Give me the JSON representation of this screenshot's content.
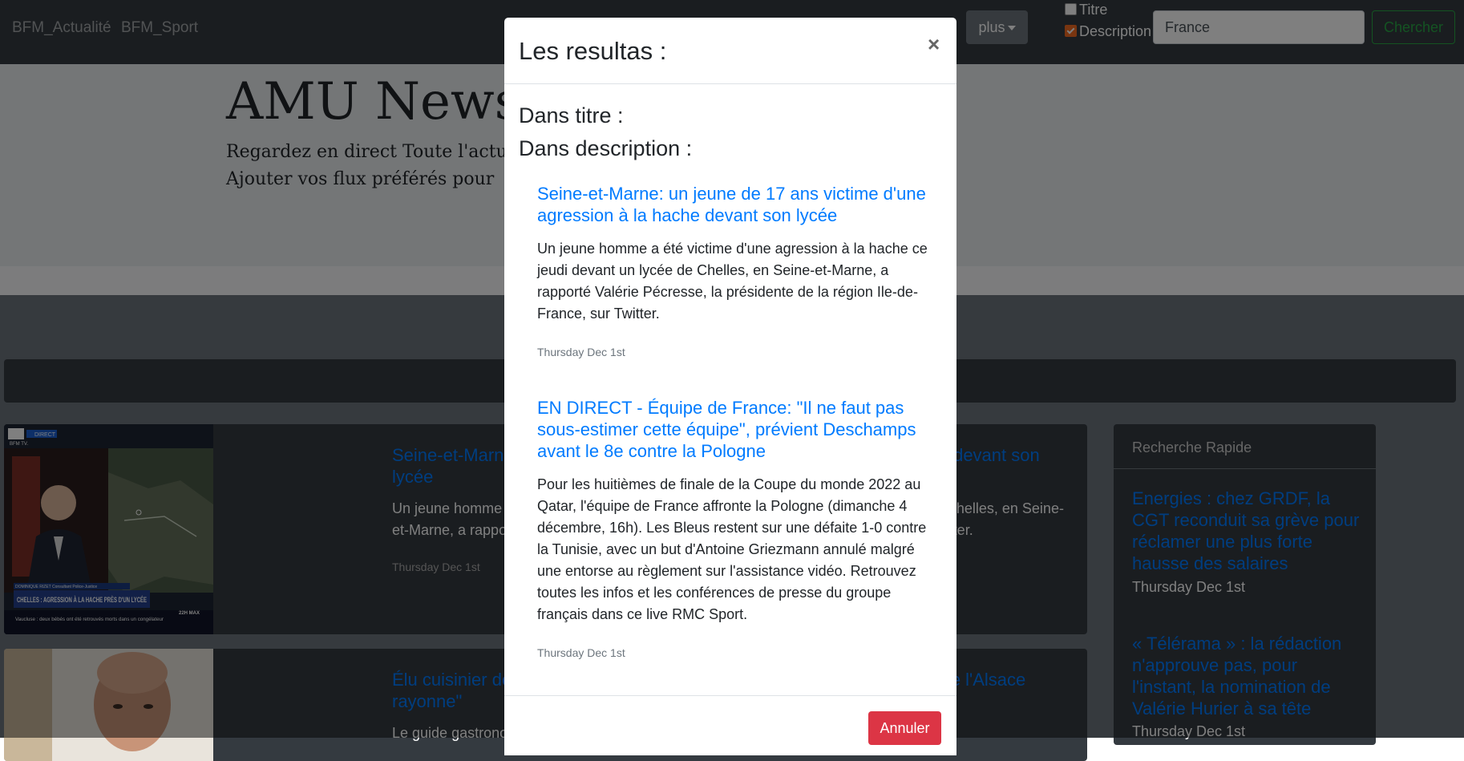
{
  "navbar": {
    "links": [
      "BFM_Actualité",
      "BFM_Sport"
    ],
    "more_label": "plus",
    "filters": [
      {
        "label": "Titre",
        "checked": false
      },
      {
        "label": "Description",
        "checked": true
      }
    ],
    "search_value": "France",
    "search_button": "Chercher"
  },
  "hero": {
    "title": "AMU News",
    "line1": "Regardez en direct Toute l'actualité",
    "line2": "Ajouter vos flux préférés pour"
  },
  "articles": [
    {
      "title": "Seine-et-Marne: un jeune de 17 ans victime d'une agression à la hache devant son lycée",
      "description": "Un jeune homme a été victime d'une agression à la hache ce jeudi devant un lycée de Chelles, en Seine-et-Marne, a rapporté Valérie Pécresse, la présidente de la région Ile-de-France, sur Twitter.",
      "date": "Thursday Dec 1st",
      "thumb_banner": "CHELLES : AGRESSION À LA HACHE PRÈS D'UN LYCÉE",
      "thumb_logo": "BFM TV.",
      "thumb_live": "DIRECT",
      "thumb_ticker": "Vaucluse : deux bébés ont été retrouvés morts dans un congélateur",
      "thumb_corner": "22H MAX",
      "thumb_name": "DOMINIQUE RIZET Consultant Police-Justice"
    },
    {
      "title": "Élu cuisinier de l'année, Michel Husser veut mettre son oeuvre \"pour que l'Alsace rayonne\"",
      "description": "Le guide gastronomique Gault et Millau a désigné le chef alsacien a",
      "date": ""
    }
  ],
  "sidebar": {
    "heading": "Recherche Rapide",
    "items": [
      {
        "title": "Energies : chez GRDF, la CGT reconduit sa grève pour réclamer une plus forte hausse des salaires",
        "date": "Thursday Dec 1st"
      },
      {
        "title": "« Télérama » : la rédaction n'approuve pas, pour l'instant, la nomination de Valérie Hurier à sa tête",
        "date": "Thursday Dec 1st"
      }
    ]
  },
  "modal": {
    "title": "Les resultas :",
    "close": "×",
    "in_title_label": "Dans titre :",
    "in_description_label": "Dans description :",
    "results": [
      {
        "title": "Seine-et-Marne: un jeune de 17 ans victime d'une agression à la hache devant son lycée",
        "description": "Un jeune homme a été victime d'une agression à la hache ce jeudi devant un lycée de Chelles, en Seine-et-Marne, a rapporté Valérie Pécresse, la présidente de la région Ile-de-France, sur Twitter.",
        "date": "Thursday Dec 1st"
      },
      {
        "title": "EN DIRECT - Équipe de France: \"Il ne faut pas sous-estimer cette équipe\", prévient Deschamps avant le 8e contre la Pologne",
        "description": "Pour les huitièmes de finale de la Coupe du monde 2022 au Qatar, l'équipe de France affronte la Pologne (dimanche 4 décembre, 16h). Les Bleus restent sur une défaite 1-0 contre la Tunisie, avec un but d'Antoine Griezmann annulé malgré une entorse au règlement sur l'assistance vidéo. Retrouvez toutes les infos et les conférences de presse du groupe français dans ce live RMC Sport.",
        "date": "Thursday Dec 1st"
      }
    ],
    "cancel_label": "Annuler"
  },
  "colors": {
    "navbar": "#343a40",
    "link": "#007bff",
    "success": "#28a745",
    "danger": "#dc3545",
    "checkbox_accent": "#f36a21"
  }
}
